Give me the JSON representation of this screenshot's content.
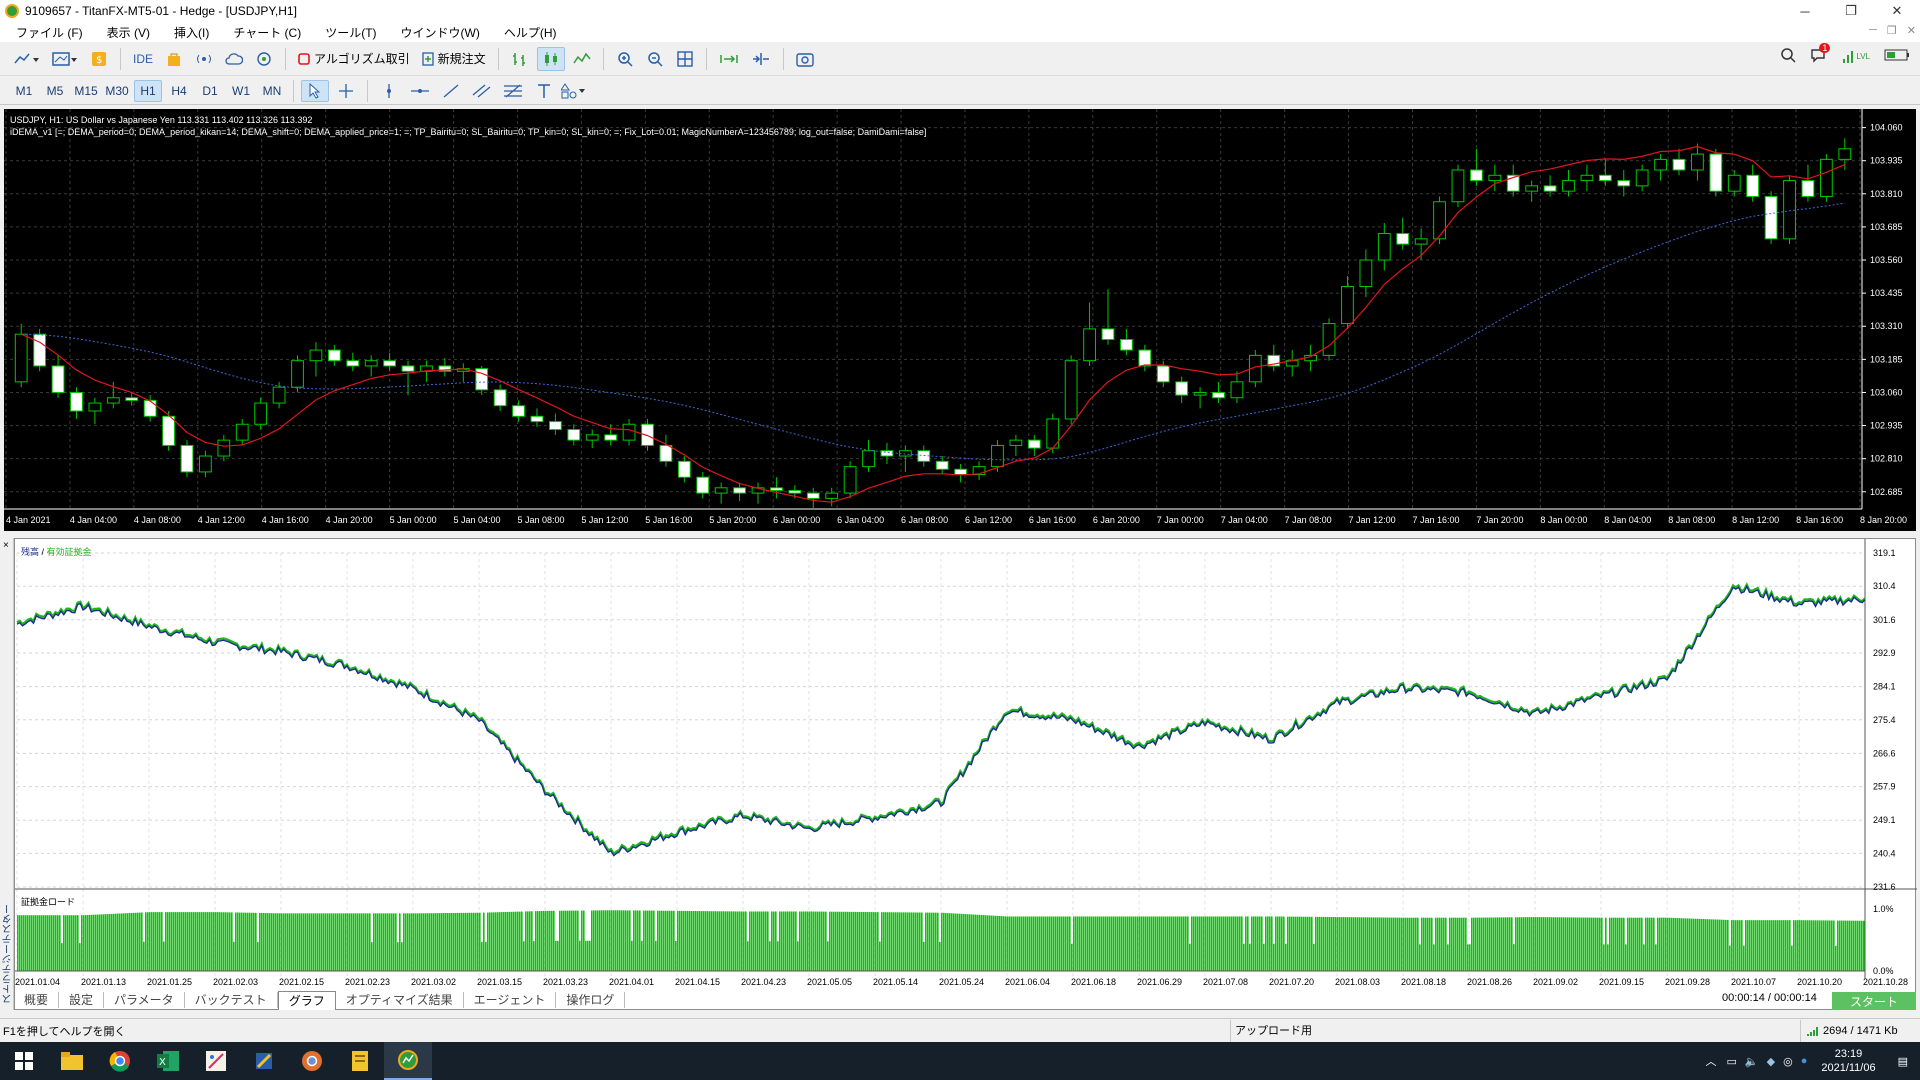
{
  "window": {
    "title": "9109657 - TitanFX-MT5-01 - Hedge - [USDJPY,H1]",
    "controls": [
      "─",
      "❐",
      "✕"
    ]
  },
  "menu": {
    "items": [
      "ファイル (F)",
      "表示 (V)",
      "挿入(I)",
      "チャート (C)",
      "ツール(T)",
      "ウインドウ(W)",
      "ヘルプ(H)"
    ],
    "mdi_controls": [
      "─",
      "❐",
      "✕"
    ]
  },
  "toolbar": {
    "ide_label": "IDE",
    "algo_label": "アルゴリズム取引",
    "new_order_label": "新規注文",
    "notification_count": "1",
    "signal_label": "LVL"
  },
  "timeframes": {
    "items": [
      "M1",
      "M5",
      "M15",
      "M30",
      "H1",
      "H4",
      "D1",
      "W1",
      "MN"
    ],
    "active": "H1"
  },
  "chart": {
    "symbol_line": "USDJPY, H1:  US Dollar vs Japanese Yen  113.331 113.402 113.326 113.392",
    "indicator_line": "iDEMA_v1 [=; DEMA_period=0; DEMA_period_kikan=14; DEMA_shift=0; DEMA_applied_price=1; =; TP_Bairitu=0; SL_Bairitu=0; TP_kin=0; SL_kin=0; =; Fix_Lot=0.01; MagicNumberA=123456789; log_out=false; DamiDami=false]",
    "price_labels": [
      "104.060",
      "103.935",
      "103.810",
      "103.685",
      "103.560",
      "103.435",
      "103.310",
      "103.185",
      "103.060",
      "102.935",
      "102.810",
      "102.685"
    ],
    "time_labels": [
      "4 Jan 2021",
      "4 Jan 04:00",
      "4 Jan 08:00",
      "4 Jan 12:00",
      "4 Jan 16:00",
      "4 Jan 20:00",
      "5 Jan 00:00",
      "5 Jan 04:00",
      "5 Jan 08:00",
      "5 Jan 12:00",
      "5 Jan 16:00",
      "5 Jan 20:00",
      "6 Jan 00:00",
      "6 Jan 04:00",
      "6 Jan 08:00",
      "6 Jan 12:00",
      "6 Jan 16:00",
      "6 Jan 20:00",
      "7 Jan 00:00",
      "7 Jan 04:00",
      "7 Jan 08:00",
      "7 Jan 12:00",
      "7 Jan 16:00",
      "7 Jan 20:00",
      "8 Jan 00:00",
      "8 Jan 04:00",
      "8 Jan 08:00",
      "8 Jan 12:00",
      "8 Jan 16:00",
      "8 Jan 20:00"
    ],
    "bull_color": "#ffffff",
    "bear_color": "#ffffff",
    "wick_color": "#00c800",
    "dema_color": "#e0161b",
    "dema2_color": "#3b6bd8"
  },
  "tester": {
    "side_label": "ストラテジーテスター",
    "legend_balance": "残高",
    "legend_sep": " / ",
    "legend_equity": "有効証拠金",
    "load_label": "証拠金ロード",
    "y_labels": [
      "319.1",
      "310.4",
      "301.6",
      "292.9",
      "284.1",
      "275.4",
      "266.6",
      "257.9",
      "249.1",
      "240.4",
      "231.6"
    ],
    "load_labels": [
      "1.0%",
      "0.0%"
    ],
    "x_labels": [
      "2021.01.04",
      "2021.01.13",
      "2021.01.25",
      "2021.02.03",
      "2021.02.15",
      "2021.02.23",
      "2021.03.02",
      "2021.03.15",
      "2021.03.23",
      "2021.04.01",
      "2021.04.15",
      "2021.04.23",
      "2021.05.05",
      "2021.05.14",
      "2021.05.24",
      "2021.06.04",
      "2021.06.18",
      "2021.06.29",
      "2021.07.08",
      "2021.07.20",
      "2021.08.03",
      "2021.08.18",
      "2021.08.26",
      "2021.09.02",
      "2021.09.15",
      "2021.09.28",
      "2021.10.07",
      "2021.10.20",
      "2021.10.28"
    ],
    "tabs": [
      "概要",
      "設定",
      "パラメータ",
      "バックテスト",
      "グラフ",
      "オプティマイズ結果",
      "エージェント",
      "操作ログ"
    ],
    "active_tab": "グラフ",
    "timer": "00:00:14 / 00:00:14",
    "start_label": "スタート",
    "balance_color": "#1b2e8c",
    "equity_color": "#1fb51f",
    "load_color": "#12c012"
  },
  "status": {
    "help": "F1を押してヘルプを開く",
    "center": "アップロード用",
    "traffic": "2694 / 1471 Kb"
  },
  "taskbar": {
    "time": "23:19",
    "date": "2021/11/06"
  },
  "chart_data": [
    {
      "type": "line",
      "title": "",
      "legend": [
        "残高",
        "有効証拠金"
      ],
      "xlabel": "",
      "ylabel": "",
      "ylim": [
        231.6,
        319.1
      ],
      "x": [
        "2021.01.04",
        "2021.01.13",
        "2021.01.25",
        "2021.02.03",
        "2021.02.15",
        "2021.02.23",
        "2021.03.02",
        "2021.03.15",
        "2021.03.23",
        "2021.04.01",
        "2021.04.15",
        "2021.04.23",
        "2021.05.05",
        "2021.05.14",
        "2021.05.24",
        "2021.06.04",
        "2021.06.18",
        "2021.06.29",
        "2021.07.08",
        "2021.07.20",
        "2021.08.03",
        "2021.08.18",
        "2021.08.26",
        "2021.09.02",
        "2021.09.15",
        "2021.09.28",
        "2021.10.07",
        "2021.10.20",
        "2021.10.28"
      ],
      "series": [
        {
          "name": "残高",
          "values": [
            300.5,
            305.0,
            299.8,
            295.5,
            293.2,
            289.5,
            283.5,
            275.1,
            256.8,
            240.3,
            245.8,
            250.2,
            246.8,
            249.7,
            253.5,
            277.8,
            275.3,
            268.4,
            274.6,
            270.1,
            279.7,
            283.6,
            282.4,
            276.9,
            281.5,
            285.9,
            310.3,
            305.7,
            306.9
          ]
        },
        {
          "name": "有効証拠金",
          "values": [
            301.0,
            305.5,
            300.2,
            296.0,
            293.6,
            289.9,
            283.9,
            275.6,
            257.2,
            240.8,
            246.3,
            250.6,
            247.2,
            250.1,
            254.0,
            278.2,
            275.8,
            268.9,
            275.0,
            270.6,
            280.1,
            284.0,
            282.9,
            277.3,
            281.9,
            286.4,
            310.8,
            306.2,
            307.3
          ]
        }
      ]
    },
    {
      "type": "bar",
      "title": "証拠金ロード",
      "ylim": [
        0,
        1.0
      ],
      "ylabel": "",
      "values": [
        0.9,
        0.9,
        0.95,
        0.95,
        0.93,
        0.93,
        0.93,
        0.94,
        0.97,
        0.98,
        0.97,
        0.96,
        0.96,
        0.95,
        0.94,
        0.88,
        0.88,
        0.88,
        0.88,
        0.88,
        0.87,
        0.86,
        0.86,
        0.87,
        0.86,
        0.86,
        0.82,
        0.82,
        0.81
      ]
    },
    {
      "type": "candlestick",
      "title": "USDJPY, H1",
      "ylim": [
        102.62,
        104.1
      ],
      "ohlc": [
        [
          103.1,
          103.32,
          103.08,
          103.28
        ],
        [
          103.28,
          103.3,
          103.14,
          103.16
        ],
        [
          103.16,
          103.2,
          103.04,
          103.06
        ],
        [
          103.06,
          103.08,
          102.96,
          102.99
        ],
        [
          102.99,
          103.04,
          102.94,
          103.02
        ],
        [
          103.02,
          103.1,
          103.0,
          103.04
        ],
        [
          103.04,
          103.06,
          103.01,
          103.03
        ],
        [
          103.03,
          103.05,
          102.95,
          102.97
        ],
        [
          102.97,
          102.99,
          102.84,
          102.86
        ],
        [
          102.86,
          102.88,
          102.74,
          102.76
        ],
        [
          102.76,
          102.84,
          102.74,
          102.82
        ],
        [
          102.82,
          102.9,
          102.8,
          102.88
        ],
        [
          102.88,
          102.96,
          102.86,
          102.94
        ],
        [
          102.94,
          103.04,
          102.92,
          103.02
        ],
        [
          103.02,
          103.1,
          103.0,
          103.08
        ],
        [
          103.08,
          103.2,
          103.06,
          103.18
        ],
        [
          103.18,
          103.25,
          103.12,
          103.22
        ],
        [
          103.22,
          103.24,
          103.16,
          103.18
        ],
        [
          103.18,
          103.21,
          103.14,
          103.16
        ],
        [
          103.16,
          103.2,
          103.12,
          103.18
        ],
        [
          103.18,
          103.21,
          103.14,
          103.16
        ],
        [
          103.16,
          103.18,
          103.05,
          103.14
        ],
        [
          103.14,
          103.18,
          103.1,
          103.16
        ],
        [
          103.16,
          103.19,
          103.12,
          103.14
        ],
        [
          103.14,
          103.17,
          103.1,
          103.15
        ],
        [
          103.15,
          103.16,
          103.05,
          103.07
        ],
        [
          103.07,
          103.09,
          102.99,
          103.01
        ],
        [
          103.01,
          103.03,
          102.95,
          102.97
        ],
        [
          102.97,
          103.0,
          102.93,
          102.95
        ],
        [
          102.95,
          102.98,
          102.9,
          102.92
        ],
        [
          102.92,
          102.94,
          102.86,
          102.88
        ],
        [
          102.88,
          102.92,
          102.85,
          102.9
        ],
        [
          102.9,
          102.94,
          102.86,
          102.88
        ],
        [
          102.88,
          102.96,
          102.86,
          102.94
        ],
        [
          102.94,
          102.96,
          102.84,
          102.86
        ],
        [
          102.86,
          102.9,
          102.78,
          102.8
        ],
        [
          102.8,
          102.82,
          102.72,
          102.74
        ],
        [
          102.74,
          102.76,
          102.66,
          102.68
        ],
        [
          102.68,
          102.72,
          102.64,
          102.7
        ],
        [
          102.7,
          102.72,
          102.65,
          102.68
        ],
        [
          102.68,
          102.72,
          102.64,
          102.7
        ],
        [
          102.7,
          102.74,
          102.66,
          102.69
        ],
        [
          102.69,
          102.71,
          102.66,
          102.68
        ],
        [
          102.68,
          102.7,
          102.62,
          102.66
        ],
        [
          102.66,
          102.7,
          102.63,
          102.68
        ],
        [
          102.68,
          102.8,
          102.66,
          102.78
        ],
        [
          102.78,
          102.88,
          102.76,
          102.84
        ],
        [
          102.84,
          102.87,
          102.79,
          102.82
        ],
        [
          102.82,
          102.86,
          102.76,
          102.84
        ],
        [
          102.84,
          102.86,
          102.78,
          102.8
        ],
        [
          102.8,
          102.82,
          102.75,
          102.77
        ],
        [
          102.77,
          102.79,
          102.72,
          102.75
        ],
        [
          102.75,
          102.8,
          102.73,
          102.78
        ],
        [
          102.78,
          102.88,
          102.76,
          102.86
        ],
        [
          102.86,
          102.9,
          102.82,
          102.88
        ],
        [
          102.88,
          102.9,
          102.82,
          102.85
        ],
        [
          102.85,
          102.98,
          102.83,
          102.96
        ],
        [
          102.96,
          103.2,
          102.94,
          103.18
        ],
        [
          103.18,
          103.4,
          103.16,
          103.3
        ],
        [
          103.3,
          103.45,
          103.24,
          103.26
        ],
        [
          103.26,
          103.3,
          103.2,
          103.22
        ],
        [
          103.22,
          103.24,
          103.14,
          103.16
        ],
        [
          103.16,
          103.18,
          103.08,
          103.1
        ],
        [
          103.1,
          103.12,
          103.02,
          103.05
        ],
        [
          103.05,
          103.08,
          103.0,
          103.06
        ],
        [
          103.06,
          103.1,
          103.02,
          103.04
        ],
        [
          103.04,
          103.14,
          103.02,
          103.1
        ],
        [
          103.1,
          103.22,
          103.08,
          103.2
        ],
        [
          103.2,
          103.24,
          103.14,
          103.16
        ],
        [
          103.16,
          103.22,
          103.12,
          103.18
        ],
        [
          103.18,
          103.24,
          103.14,
          103.2
        ],
        [
          103.2,
          103.34,
          103.18,
          103.32
        ],
        [
          103.32,
          103.5,
          103.3,
          103.46
        ],
        [
          103.46,
          103.6,
          103.42,
          103.56
        ],
        [
          103.56,
          103.7,
          103.52,
          103.66
        ],
        [
          103.66,
          103.72,
          103.6,
          103.62
        ],
        [
          103.62,
          103.68,
          103.56,
          103.64
        ],
        [
          103.64,
          103.8,
          103.62,
          103.78
        ],
        [
          103.78,
          103.92,
          103.76,
          103.9
        ],
        [
          103.9,
          103.98,
          103.84,
          103.86
        ],
        [
          103.86,
          103.92,
          103.82,
          103.88
        ],
        [
          103.88,
          103.92,
          103.8,
          103.82
        ],
        [
          103.82,
          103.86,
          103.78,
          103.84
        ],
        [
          103.84,
          103.88,
          103.8,
          103.82
        ],
        [
          103.82,
          103.9,
          103.8,
          103.86
        ],
        [
          103.86,
          103.92,
          103.82,
          103.88
        ],
        [
          103.88,
          103.94,
          103.84,
          103.86
        ],
        [
          103.86,
          103.9,
          103.8,
          103.84
        ],
        [
          103.84,
          103.92,
          103.82,
          103.9
        ],
        [
          103.9,
          103.96,
          103.86,
          103.94
        ],
        [
          103.94,
          103.98,
          103.88,
          103.9
        ],
        [
          103.9,
          104.0,
          103.86,
          103.96
        ],
        [
          103.96,
          103.98,
          103.8,
          103.82
        ],
        [
          103.82,
          103.9,
          103.8,
          103.88
        ],
        [
          103.88,
          103.92,
          103.78,
          103.8
        ],
        [
          103.8,
          103.82,
          103.62,
          103.64
        ],
        [
          103.64,
          103.88,
          103.62,
          103.86
        ],
        [
          103.86,
          103.92,
          103.78,
          103.8
        ],
        [
          103.8,
          103.96,
          103.78,
          103.94
        ],
        [
          103.94,
          104.02,
          103.9,
          103.98
        ]
      ]
    }
  ]
}
